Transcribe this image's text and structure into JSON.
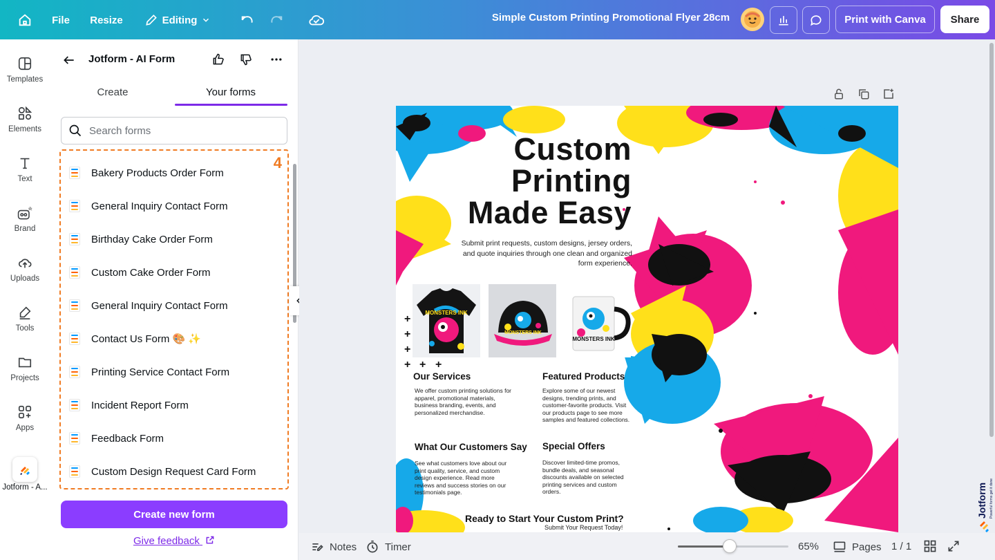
{
  "topbar": {
    "file": "File",
    "resize": "Resize",
    "editing": "Editing",
    "doc_title": "Simple Custom Printing Promotional Flyer 28cm",
    "print": "Print with Canva",
    "share": "Share"
  },
  "rail": {
    "items": [
      "Templates",
      "Elements",
      "Text",
      "Brand",
      "Uploads",
      "Tools",
      "Projects",
      "Apps"
    ],
    "active_app": "Jotform - A..."
  },
  "panel": {
    "title": "Jotform - AI Form",
    "tabs": [
      "Create",
      "Your forms"
    ],
    "search_placeholder": "Search forms",
    "badge": "4",
    "forms": [
      "Bakery Products Order Form",
      "General Inquiry Contact Form",
      "Birthday Cake Order Form",
      "Custom Cake Order Form",
      "General Inquiry Contact Form",
      "Contact Us Form 🎨 ✨",
      "Printing Service Contact Form",
      "Incident Report Form",
      "Feedback Form",
      "Custom Design Request Card Form"
    ],
    "create_button": "Create new form",
    "feedback": "Give feedback"
  },
  "flyer": {
    "hero": [
      "Custom",
      "Printing",
      "Made Easy"
    ],
    "intro": "Submit print requests, custom designs, jersey orders, and quote inquiries through one clean and organized form experience.",
    "sections": [
      {
        "title": "Our Services",
        "text": "We offer custom printing solutions for apparel, promotional materials, business branding, events, and personalized merchandise."
      },
      {
        "title": "Featured Products",
        "text": "Explore some of our newest designs, trending prints, and customer-favorite products. Visit our products page to see more samples and featured collections."
      },
      {
        "title": "What Our Customers Say",
        "text": "See what customers love about our print quality, service, and custom design experience. Read more reviews and success stories on our testimonials page."
      },
      {
        "title": "Special Offers",
        "text": "Discover limited-time promos, bundle deals, and seasonal discounts available on selected printing services and custom orders."
      }
    ],
    "cta": "Ready to Start Your Custom Print?",
    "cta_sub": "Submit Your Request Today!",
    "products": [
      "jersey",
      "cap",
      "mug"
    ],
    "product_text": "MONSTERS INK"
  },
  "bottombar": {
    "notes": "Notes",
    "timer": "Timer",
    "zoom": "65%",
    "zoom_level": 0.47,
    "pages": "Pages",
    "page_count": "1 / 1"
  },
  "jotform_badge": "Jotform",
  "jotform_tagline": "Powerful forms get it done",
  "colors": {
    "accent": "#8b3dff",
    "tab_underline": "#7d2ae8",
    "highlight": "#f07b22",
    "splash_cyan": "#16a9e9",
    "splash_yellow": "#ffe01a",
    "splash_magenta": "#f0197d"
  }
}
